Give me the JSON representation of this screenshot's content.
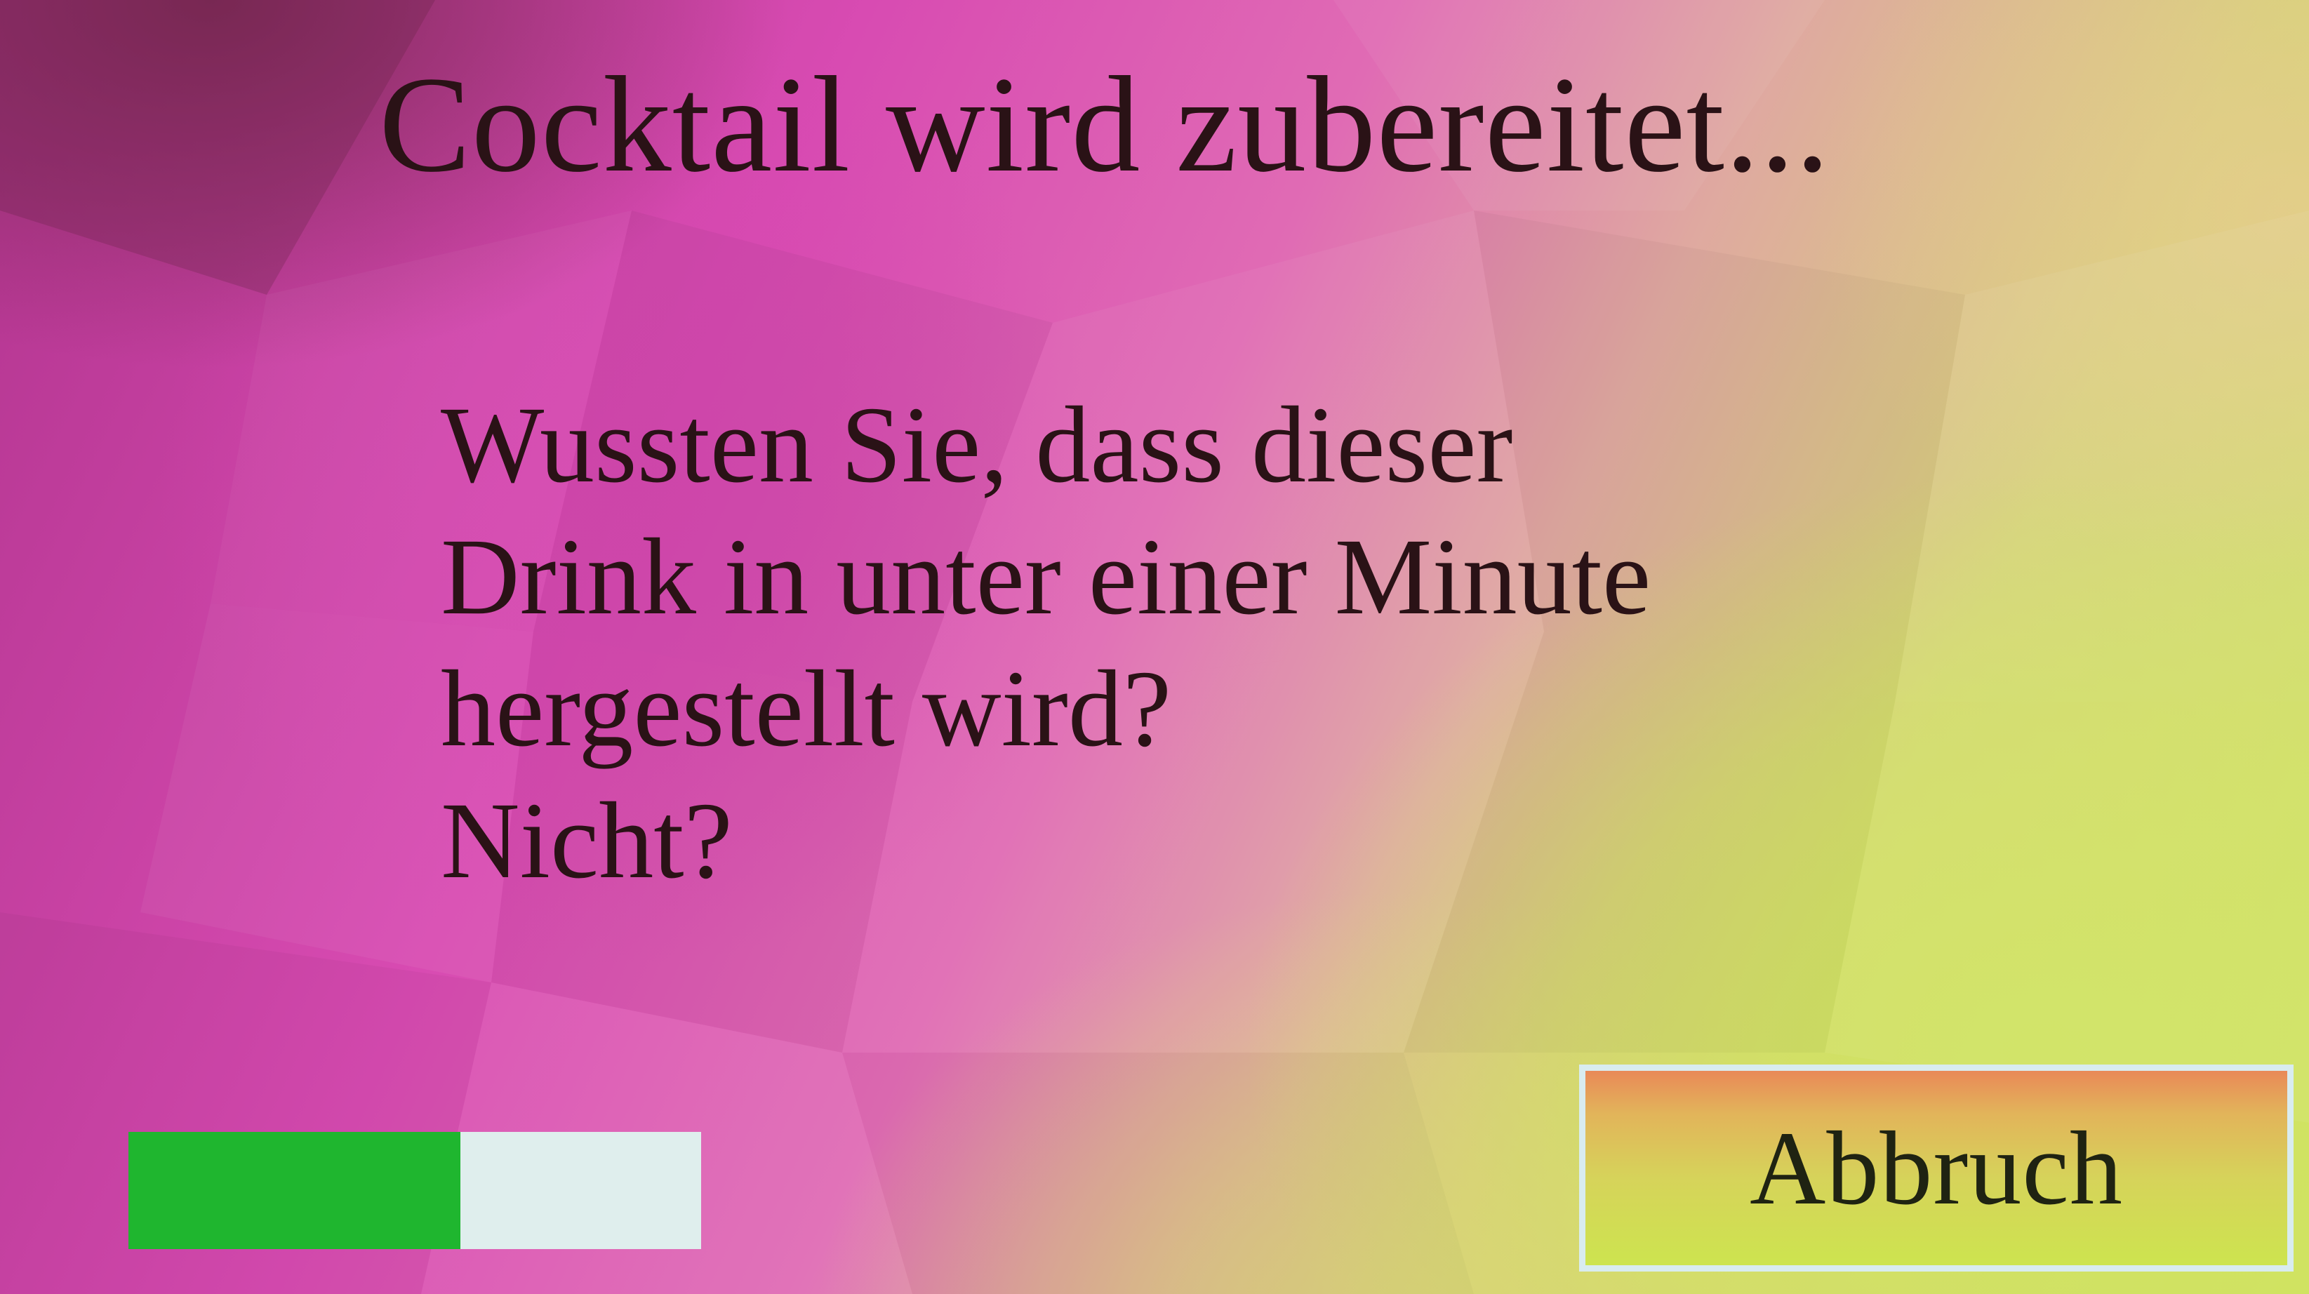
{
  "screen": {
    "title": "Cocktail wird zubereitet...",
    "message_lines": [
      "Wussten Sie, dass dieser",
      "Drink in unter einer Minute",
      "hergestellt wird?",
      "Nicht?"
    ]
  },
  "progress": {
    "fraction": 0.58,
    "fill_color": "#1fb62f",
    "track_color": "#dfeeed"
  },
  "cancel_button": {
    "label": "Abbruch"
  }
}
